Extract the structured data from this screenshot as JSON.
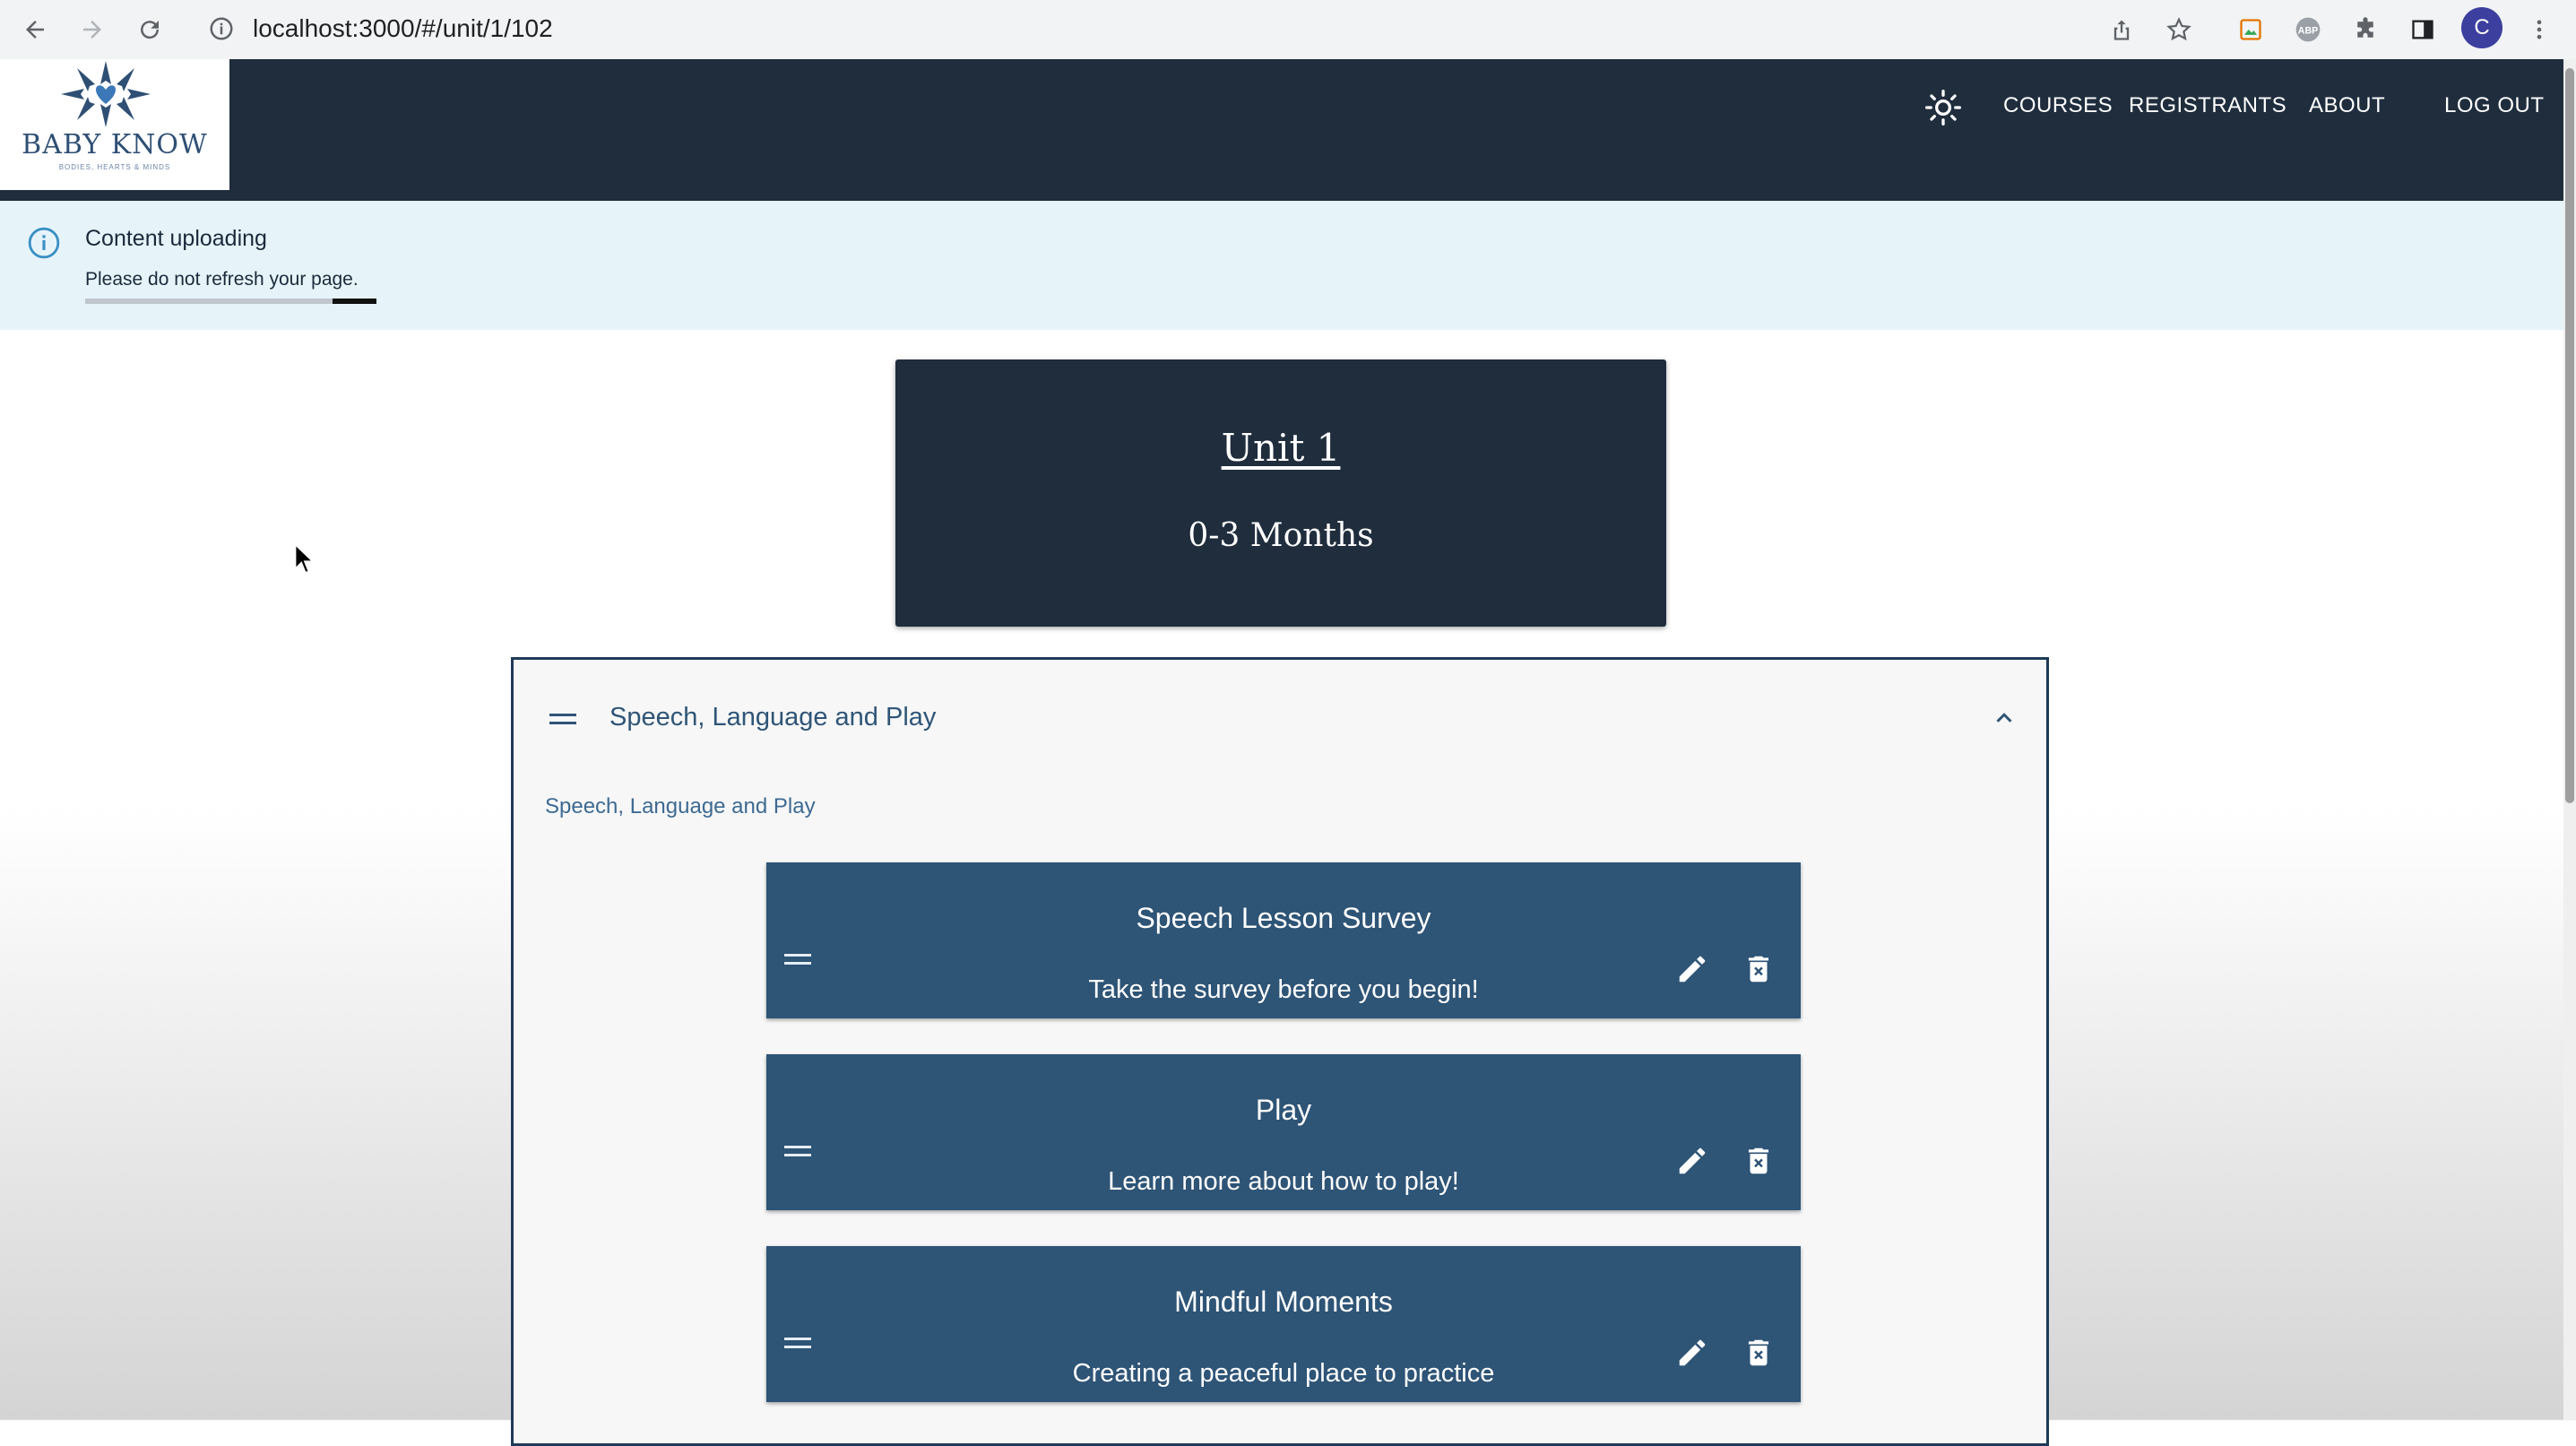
{
  "browser": {
    "url": "localhost:3000/#/unit/1/102",
    "profile_initial": "C"
  },
  "header": {
    "logo_text": "BABY KNOW",
    "logo_tagline": "BODIES, HEARTS & MINDS",
    "nav": [
      "COURSES",
      "REGISTRANTS",
      "ABOUT",
      "LOG OUT"
    ]
  },
  "alert": {
    "title": "Content uploading",
    "message": "Please do not refresh your page.",
    "progress": 0.15
  },
  "unit": {
    "title": "Unit 1",
    "subtitle": "0-3 Months"
  },
  "section": {
    "title": "Speech, Language and Play",
    "description": "Speech, Language and Play",
    "lessons": [
      {
        "title": "Speech Lesson Survey",
        "description": "Take the survey before you begin!"
      },
      {
        "title": "Play",
        "description": "Learn more about how to play!"
      },
      {
        "title": "Mindful Moments",
        "description": "Creating a peaceful place to practice"
      }
    ]
  },
  "colors": {
    "header_bg": "#1f2d3d",
    "lesson_bg": "#2e5476",
    "alert_bg": "#e6f4fa",
    "accent": "#2f5577"
  }
}
